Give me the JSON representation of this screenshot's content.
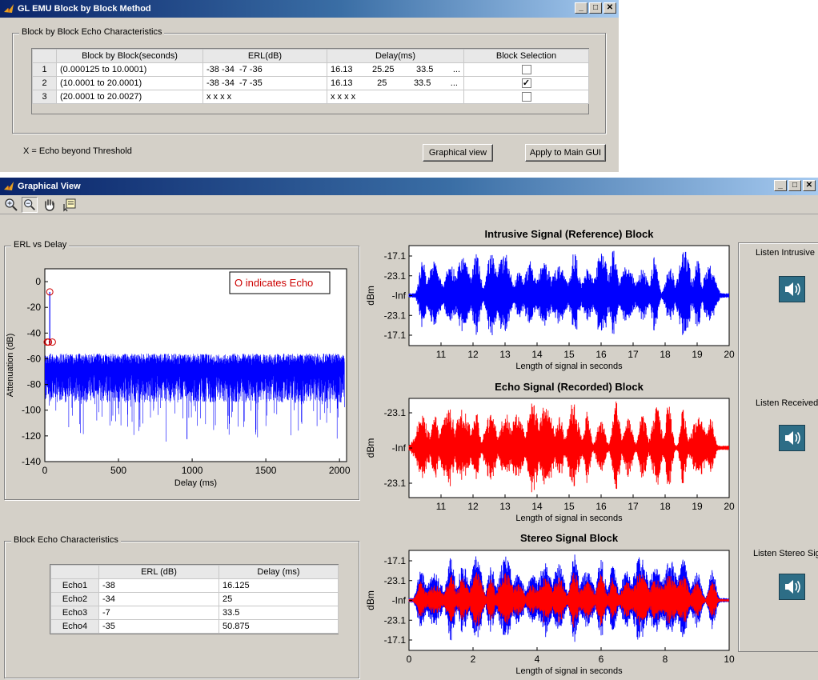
{
  "top_window": {
    "title": "GL EMU Block by Block Method",
    "group_label": "Block by Block Echo Characteristics",
    "columns": [
      "Block by Block(seconds)",
      "ERL(dB)",
      "Delay(ms)",
      "Block Selection"
    ],
    "rows": [
      {
        "num": "1",
        "block": "(0.000125 to 10.0001)",
        "erl": "-38 -34  -7 -36",
        "delay": "16.13        25.25         33.5        ...",
        "selected": false
      },
      {
        "num": "2",
        "block": "(10.0001 to 20.0001)",
        "erl": "-38 -34  -7 -35",
        "delay": "16.13          25           33.5        ...",
        "selected": true
      },
      {
        "num": "3",
        "block": "(20.0001 to 20.0027)",
        "erl": "x x x x",
        "delay": "x x x x",
        "selected": false
      }
    ],
    "legend_note": "X = Echo beyond Threshold",
    "graphical_view_button": "Graphical view",
    "apply_button": "Apply to Main GUI"
  },
  "graph_window": {
    "title": "Graphical View",
    "erl_group_label": "ERL vs  Delay",
    "block_echo_group_label": "Block Echo Characteristics",
    "echo_table": {
      "columns": [
        "ERL (dB)",
        "Delay (ms)"
      ],
      "rows": [
        {
          "name": "Echo1",
          "erl": "-38",
          "delay": "16.125"
        },
        {
          "name": "Echo2",
          "erl": "-34",
          "delay": "25"
        },
        {
          "name": "Echo3",
          "erl": "-7",
          "delay": "33.5"
        },
        {
          "name": "Echo4",
          "erl": "-35",
          "delay": "50.875"
        }
      ]
    },
    "listen": {
      "intrusive": "Listen Intrusive",
      "received": "Listen Received",
      "stereo": "Listen Stereo Signal"
    }
  },
  "chart_data": [
    {
      "type": "line",
      "legend_text": "O indicates Echo",
      "xlabel": "Delay (ms)",
      "ylabel": "Attenuation (dB)",
      "xlim": [
        0,
        2048
      ],
      "ylim": [
        -140,
        10
      ],
      "xticks": [
        "0",
        "500",
        "1000",
        "1500",
        "2000"
      ],
      "yticks": [
        "0",
        "-20",
        "-40",
        "-60",
        "-80",
        "-100",
        "-120",
        "-140"
      ],
      "echo_points": [
        {
          "x": 16.125,
          "y": -47
        },
        {
          "x": 25,
          "y": -47
        },
        {
          "x": 33.5,
          "y": -8
        },
        {
          "x": 50.875,
          "y": -47
        }
      ],
      "color": "#0000ff",
      "marker_color": "#cc0000"
    },
    {
      "type": "line",
      "title": "Intrusive Signal (Reference) Block",
      "xlabel": "Length of signal in seconds",
      "ylabel": "dBm",
      "xlim": [
        10,
        20
      ],
      "xticks": [
        "11",
        "12",
        "13",
        "14",
        "15",
        "16",
        "17",
        "18",
        "19",
        "20"
      ],
      "yticks": [
        "-17.1",
        "-23.1",
        "-Inf",
        "-23.1",
        "-17.1"
      ],
      "color": "#0000ff"
    },
    {
      "type": "line",
      "title": "Echo Signal (Recorded) Block",
      "xlabel": "Length of signal in seconds",
      "ylabel": "dBm",
      "xlim": [
        10,
        20
      ],
      "xticks": [
        "11",
        "12",
        "13",
        "14",
        "15",
        "16",
        "17",
        "18",
        "19",
        "20"
      ],
      "yticks": [
        "-23.1",
        "-Inf",
        "-23.1"
      ],
      "color": "#ff0000"
    },
    {
      "type": "line",
      "title": "Stereo Signal Block",
      "xlabel": "Length of signal in seconds",
      "ylabel": "dBm",
      "xlim": [
        0,
        10
      ],
      "xticks": [
        "0",
        "2",
        "4",
        "6",
        "8",
        "10"
      ],
      "yticks": [
        "-17.1",
        "-23.1",
        "-Inf",
        "-23.1",
        "-17.1"
      ],
      "series": [
        {
          "color": "#0000ff"
        },
        {
          "color": "#ff0000"
        }
      ]
    }
  ]
}
